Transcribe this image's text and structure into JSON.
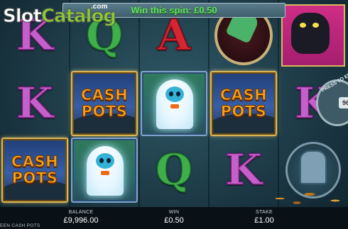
{
  "branding": {
    "logo_slot": "Slot",
    "logo_catalog": "Catalog",
    "logo_com": ".com"
  },
  "win_banner": {
    "text": "Win this spin: £0.50",
    "color": "#5ce84e"
  },
  "reels": [
    {
      "symbols": [
        "K",
        "K",
        "CASH POTS"
      ]
    },
    {
      "symbols": [
        "Q",
        "CASH POTS",
        "ghost"
      ]
    },
    {
      "symbols": [
        "A",
        "ghost",
        "Q"
      ]
    },
    {
      "symbols": [
        "green-hand",
        "CASH POTS",
        "K"
      ]
    },
    {
      "symbols": [
        "black-cat",
        "K",
        "tombstone"
      ]
    }
  ],
  "symbol_colors": {
    "K": "#c55fc9",
    "Q": "#3fae4b",
    "A": "#d82532",
    "cash_pots": "#f5a414"
  },
  "cash_pots": {
    "line1": "CASH",
    "line2": "POTS"
  },
  "side_control": {
    "label": "PRESS TO END",
    "value": "96"
  },
  "status_bar": {
    "balance_label": "BALANCE",
    "balance_value": "£9,996.00",
    "win_label": "WIN",
    "win_value": "£0.50",
    "stake_label": "STAKE",
    "stake_value": "£1.00",
    "game_name": "EEN CASH POTS"
  }
}
